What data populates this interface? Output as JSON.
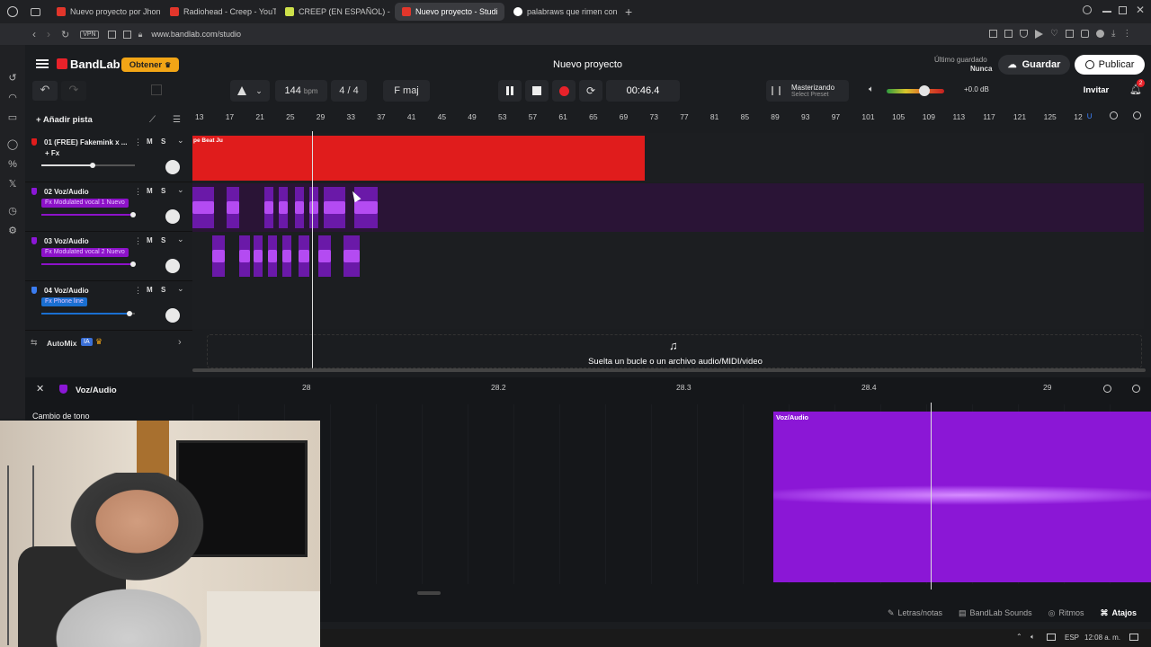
{
  "browser": {
    "tabs": [
      {
        "label": "Nuevo proyecto por Jhon",
        "color": "#e2362b",
        "active": false
      },
      {
        "label": "Radiohead - Creep - YouTu",
        "color": "#e2362b",
        "active": false
      },
      {
        "label": "CREEP (EN ESPAÑOL) - Ra",
        "color": "#cde04a",
        "active": false
      },
      {
        "label": "Nuevo proyecto - Studi",
        "color": "#e2362b",
        "active": true
      },
      {
        "label": "palabraws que rimen con c",
        "color": "#4285f4",
        "active": false
      }
    ],
    "new_tab": "+",
    "url": "www.bandlab.com/studio",
    "vpn": "VPN"
  },
  "header": {
    "brand": "BandLab",
    "get_button": "Obtener",
    "project_title": "Nuevo proyecto",
    "last_saved_label": "Último guardado",
    "last_saved_value": "Nunca",
    "save_button": "Guardar",
    "publish_button": "Publicar"
  },
  "transport": {
    "bpm_value": "144",
    "bpm_unit": "bpm",
    "time_signature": "4 / 4",
    "key": "F maj",
    "time": "00:46.4",
    "mastering_label": "Masterizando",
    "mastering_preset": "Select Preset",
    "volume_db": "+0.0 dB",
    "volume_level": 0.65,
    "invite_button": "Invitar",
    "notification_count": "2"
  },
  "tracks_panel": {
    "add_track": "Añadir pista",
    "automix_label": "AutoMix",
    "automix_badge": "IA"
  },
  "ruler": {
    "ticks": [
      "13",
      "17",
      "21",
      "25",
      "29",
      "33",
      "37",
      "41",
      "45",
      "49",
      "53",
      "57",
      "61",
      "65",
      "69",
      "73",
      "77",
      "81",
      "85",
      "89",
      "93",
      "97",
      "101",
      "105",
      "109",
      "113",
      "117",
      "121",
      "125",
      "12"
    ]
  },
  "tracks": [
    {
      "name": "01  (FREE) Fakemink x ...",
      "fx": "+ Fx",
      "fx_color": "",
      "volume": 0.55,
      "clip_color": "#e01c1c",
      "clip_label": "pe Beat Ju"
    },
    {
      "name": "02  Voz/Audio",
      "fx": "Fx  Modulated vocal 1  Nuevo",
      "fx_color": "#8d12c9",
      "volume": 0.98,
      "clip_color": "#7a1db5",
      "clip_label": ""
    },
    {
      "name": "03  Voz/Audio",
      "fx": "Fx  Modulated vocal 2  Nuevo",
      "fx_color": "#8d12c9",
      "volume": 0.98,
      "clip_color": "#7a1db5",
      "clip_label": ""
    },
    {
      "name": "04  Voz/Audio",
      "fx": "Fx  Phone line",
      "fx_color": "#1a6fd1",
      "volume": 0.94,
      "clip_color": "",
      "clip_label": ""
    }
  ],
  "track_controls": {
    "mute": "M",
    "solo": "S"
  },
  "drop_zone": "Suelta un bucle o un archivo audio/MIDI/video",
  "editor": {
    "track_name": "Voz/Audio",
    "section_label": "Cambio de tono",
    "ruler_ticks": [
      "28",
      "28.2",
      "28.3",
      "28.4",
      "29"
    ],
    "clip_label": "Voz/Audio"
  },
  "bottom_bar": {
    "lyrics": "Letras/notas",
    "sounds": "BandLab Sounds",
    "rhythms": "Ritmos",
    "shortcuts": "Atajos"
  },
  "system": {
    "lang": "ESP",
    "clock": "12:08 a. m."
  },
  "colors": {
    "accent_red": "#e01c1c",
    "vocal_purple": "#8b17d6",
    "get_button": "#f2a516",
    "record": "#e8222a"
  }
}
